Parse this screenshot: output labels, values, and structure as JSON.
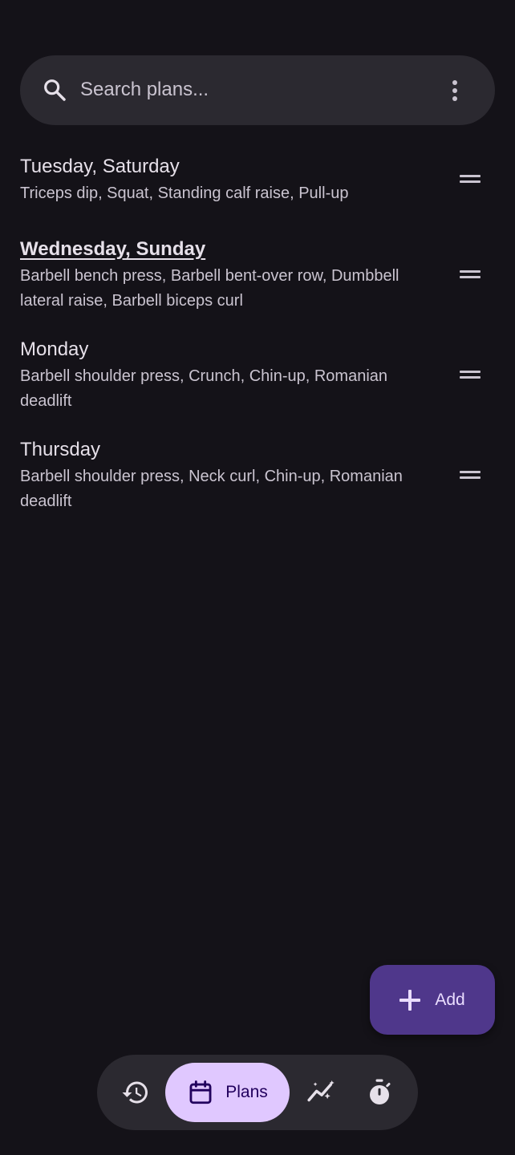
{
  "search": {
    "placeholder": "Search plans...",
    "search_icon": "search-icon",
    "menu_icon": "more-vert-icon"
  },
  "plans": [
    {
      "title": "Tuesday, Saturday",
      "exercises": "Triceps dip, Squat, Standing calf raise, Pull-up",
      "active": false
    },
    {
      "title": "Wednesday, Sunday",
      "exercises": "Barbell bench press, Barbell bent-over row, Dumbbell lateral raise, Barbell biceps curl",
      "active": true
    },
    {
      "title": "Monday",
      "exercises": "Barbell shoulder press, Crunch, Chin-up, Romanian deadlift",
      "active": false
    },
    {
      "title": "Thursday",
      "exercises": "Barbell shoulder press, Neck curl, Chin-up, Romanian deadlift",
      "active": false
    }
  ],
  "fab": {
    "label": "Add",
    "icon": "plus-icon"
  },
  "nav": {
    "items": [
      {
        "icon": "history-icon",
        "label": ""
      },
      {
        "icon": "calendar-icon",
        "label": "Plans",
        "selected": true
      },
      {
        "icon": "graphs-icon",
        "label": ""
      },
      {
        "icon": "timer-icon",
        "label": ""
      }
    ]
  },
  "colors": {
    "background": "#141218",
    "surface": "#2b2930",
    "fab": "#4f378b",
    "nav_selected": "#e0c8ff"
  }
}
